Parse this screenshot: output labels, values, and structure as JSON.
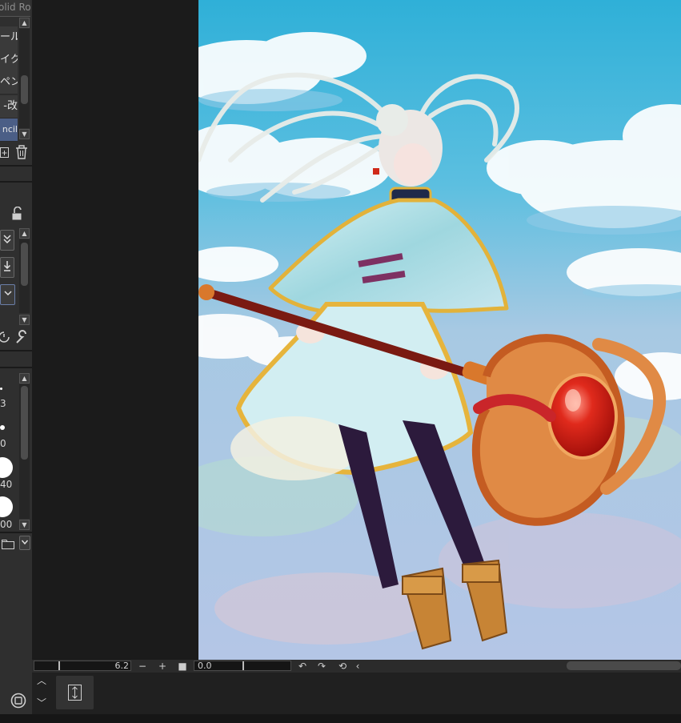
{
  "left_panel": {
    "header_text": "olid Ro",
    "brush_items": [
      {
        "label": "ール"
      },
      {
        "label": "イク"
      },
      {
        "label": "ペン"
      },
      {
        "label": "-改"
      },
      {
        "label": "ncil",
        "selected": true
      }
    ],
    "size_values": [
      {
        "label": "3"
      },
      {
        "label": "0"
      },
      {
        "label": "40"
      },
      {
        "label": "00"
      }
    ]
  },
  "status_bar": {
    "zoom_value": "6.2",
    "zoom_out": "−",
    "zoom_in": "+",
    "angle_value": "0.0"
  },
  "colors": {
    "sky": "#2fb0d8",
    "panel_bg": "#2f2f2f",
    "workspace_bg": "#1b1b1b",
    "selection": "#4b5e86"
  },
  "icons": [
    "chevron-up-icon",
    "chevron-down-icon",
    "add-layer-icon",
    "trash-icon",
    "lock-icon",
    "merge-down-icon",
    "download-icon",
    "dropdown-icon",
    "rotate-icon",
    "wrench-icon",
    "folder-icon",
    "reset-icon",
    "navigator-icon",
    "flip-icon",
    "target-icon"
  ]
}
